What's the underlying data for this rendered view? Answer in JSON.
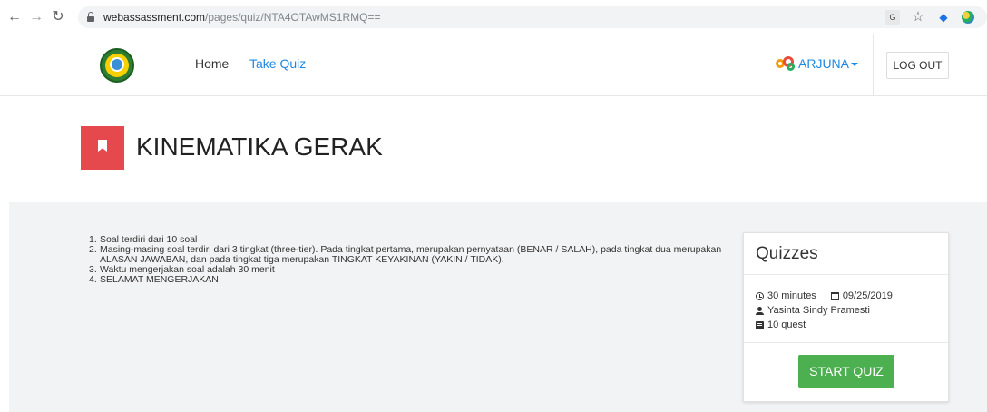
{
  "browser": {
    "back_icon": "arrow-left-icon",
    "forward_icon": "arrow-right-icon",
    "reload_icon": "reload-icon",
    "url_domain": "webassassment.com",
    "url_path": "/pages/quiz/NTA4OTAwMS1RMQ=="
  },
  "navbar": {
    "home": "Home",
    "take_quiz": "Take Quiz",
    "user": "ARJUNA",
    "logout": "LOG OUT",
    "link_color": "#1e88e5"
  },
  "page": {
    "title": "KINEMATIKA GERAK",
    "title_icon_color": "#e5484d"
  },
  "rules": [
    {
      "num": "1.",
      "text": "Soal terdiri dari 10 soal"
    },
    {
      "num": "2.",
      "text": "Masing-masing soal terdiri dari 3 tingkat (three-tier). Pada tingkat pertama, merupakan pernyataan (BENAR / SALAH), pada tingkat dua merupakan ALASAN JAWABAN, dan pada tingkat tiga merupakan TINGKAT KEYAKINAN (YAKIN / TIDAK)."
    },
    {
      "num": "3.",
      "text": "Waktu mengerjakan soal adalah 30 menit"
    },
    {
      "num": "4.",
      "text": "SELAMAT MENGERJAKAN"
    }
  ],
  "card": {
    "title": "Quizzes",
    "duration": "30 minutes",
    "date": "09/25/2019",
    "author": "Yasinta Sindy Pramesti",
    "questions": "10 quest",
    "start_button": "START QUIZ",
    "button_color": "#4caf50"
  }
}
